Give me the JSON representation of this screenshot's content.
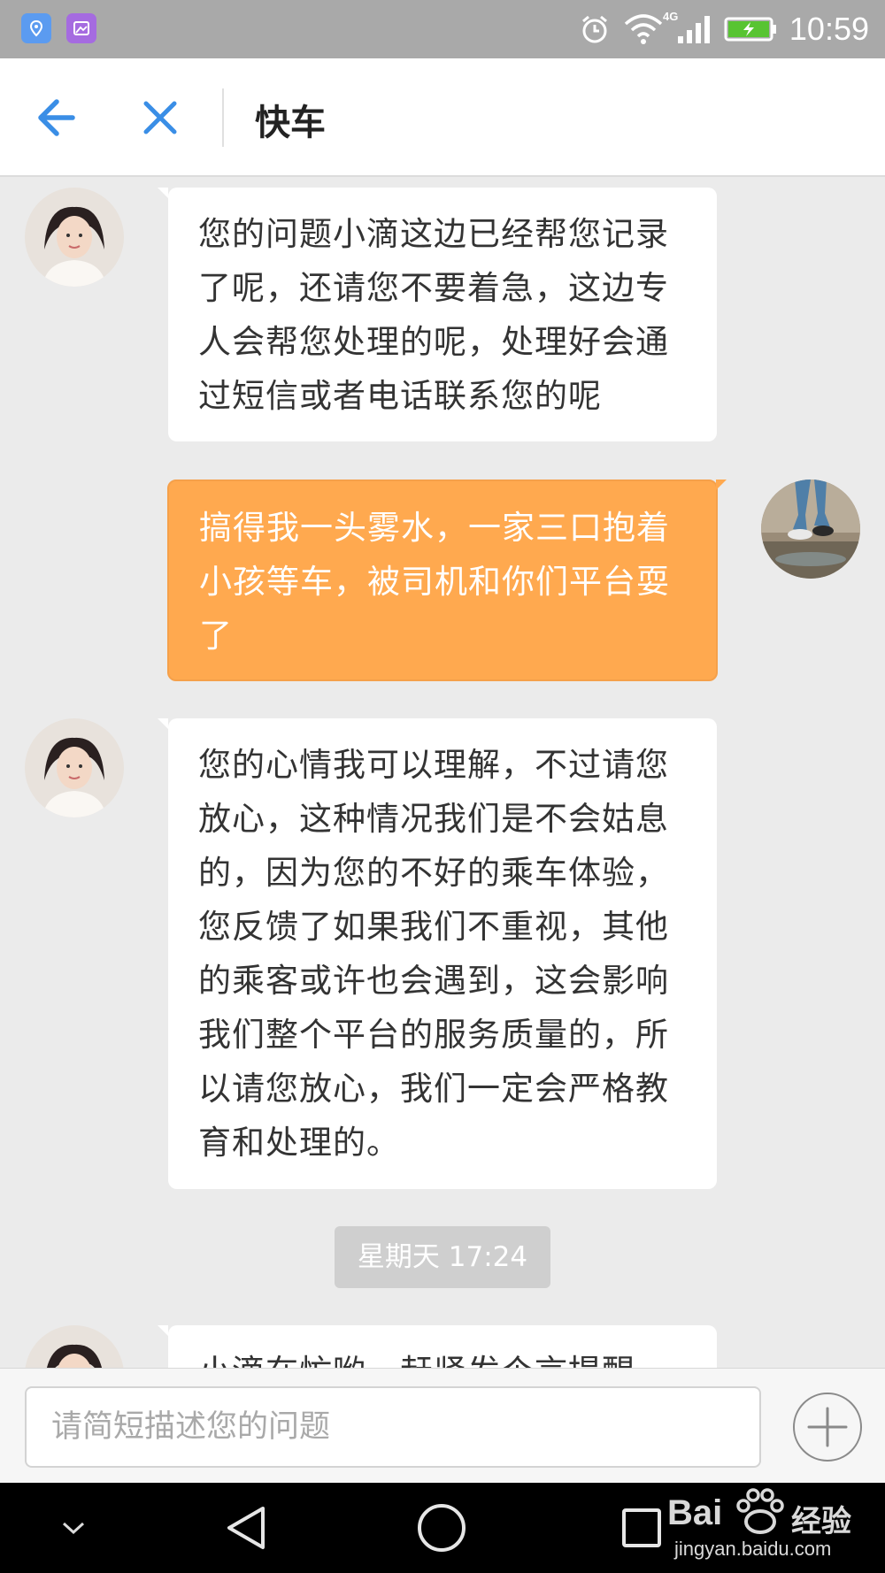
{
  "status_bar": {
    "time": "10:59",
    "network": "4G",
    "icons": [
      "location-app-icon",
      "gallery-app-icon",
      "alarm-icon",
      "wifi-icon",
      "signal-icon",
      "battery-charging-icon"
    ]
  },
  "header": {
    "title": "快车",
    "back_icon": "back-arrow-icon",
    "close_icon": "close-icon"
  },
  "messages": [
    {
      "sender": "agent",
      "text": "您的问题小滴这边已经帮您记录了呢，还请您不要着急，这边专人会帮您处理的呢，处理好会通过短信或者电话联系您的呢"
    },
    {
      "sender": "user",
      "text": "搞得我一头雾水，一家三口抱着小孩等车，被司机和你们平台耍了"
    },
    {
      "sender": "agent",
      "text": "您的心情我可以理解，不过请您放心，这种情况我们是不会姑息的，因为您的不好的乘车体验，您反馈了如果我们不重视，其他的乘客或许也会遇到，这会影响我们整个平台的服务质量的，所以请您放心，我们一定会严格教育和处理的。"
    },
    {
      "sender": "agent",
      "text": "小滴在忙哟，赶紧发个言提醒"
    }
  ],
  "timestamp": "星期天 17:24",
  "input": {
    "placeholder": "请简短描述您的问题",
    "value": "",
    "add_icon": "plus-icon"
  },
  "nav_bar": {
    "icons": [
      "chevron-down-icon",
      "back-triangle-icon",
      "home-circle-icon",
      "recents-square-icon"
    ]
  },
  "watermark": {
    "brand": "Bai",
    "brand_suffix": "经验",
    "url": "jingyan.baidu.com"
  },
  "colors": {
    "accent_blue": "#3a8ee6",
    "user_bubble": "#ffa94f",
    "agent_bubble": "#ffffff",
    "chat_background": "#ebebeb"
  }
}
